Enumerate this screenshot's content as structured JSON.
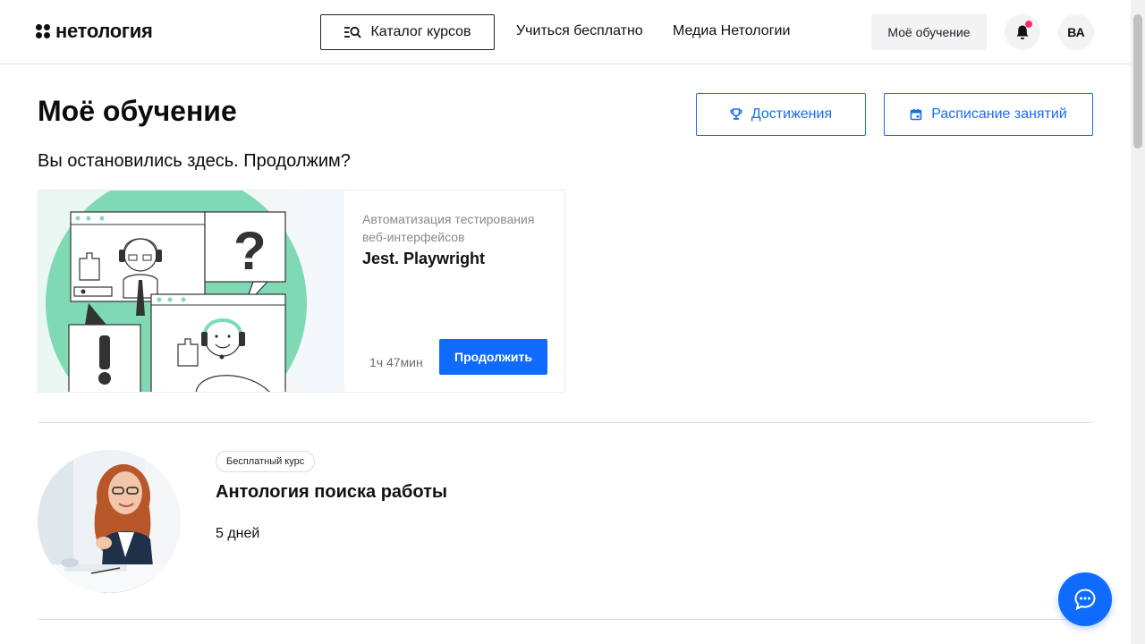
{
  "header": {
    "logo_text": "нетология",
    "catalog_label": "Каталог курсов",
    "nav": [
      {
        "label": "Учиться бесплатно"
      },
      {
        "label": "Медиа Нетологии"
      }
    ],
    "my_learning_label": "Моё обучение",
    "avatar_initials": "ВА",
    "notification_dot_color": "#ff2d6b"
  },
  "main": {
    "title": "Моё обучение",
    "achievements_label": "Достижения",
    "schedule_label": "Расписание занятий",
    "subtitle": "Вы остановились здесь. Продолжим?"
  },
  "continue_card": {
    "category": "Автоматизация тестирования веб-интерфейсов",
    "title": "Jest. Playwright",
    "duration": "1ч 47мин",
    "button_label": "Продолжить"
  },
  "course": {
    "badge": "Бесплатный курс",
    "title": "Антология поиска работы",
    "duration": "5 дней"
  },
  "colors": {
    "accent": "#0f6bff",
    "illustration_green": "#7fd9b4"
  }
}
